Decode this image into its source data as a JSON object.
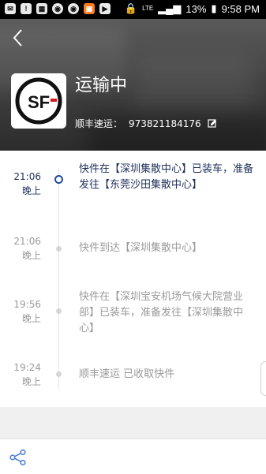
{
  "status_bar": {
    "battery": "13%",
    "time": "9:58 PM",
    "network": "LTE"
  },
  "header": {
    "title": "运输中",
    "courier": "顺丰速运：",
    "tracking_number": "973821184176"
  },
  "timeline": [
    {
      "time": "21:06",
      "period": "晚上",
      "text": "快件在【深圳集散中心】已装车，准备发往【东莞沙田集散中心】",
      "active": true
    },
    {
      "time": "21:06",
      "period": "晚上",
      "text": "快件到达【深圳集散中心】",
      "active": false
    },
    {
      "time": "19:56",
      "period": "晚上",
      "text": "快件在【深圳宝安机场气候大院营业部】已装车，准备发往【深圳集散中心】",
      "active": false
    },
    {
      "time": "19:24",
      "period": "晚上",
      "text": "顺丰速运 已收取快件",
      "active": false
    }
  ],
  "colors": {
    "accent": "#1e4d9a",
    "muted_text": "#9a9a9a",
    "header_bg": "#3f3f3f"
  },
  "icons": {
    "back": "back-arrow-icon",
    "edit": "edit-icon",
    "share": "share-icon",
    "logo": "sf-express-logo"
  }
}
